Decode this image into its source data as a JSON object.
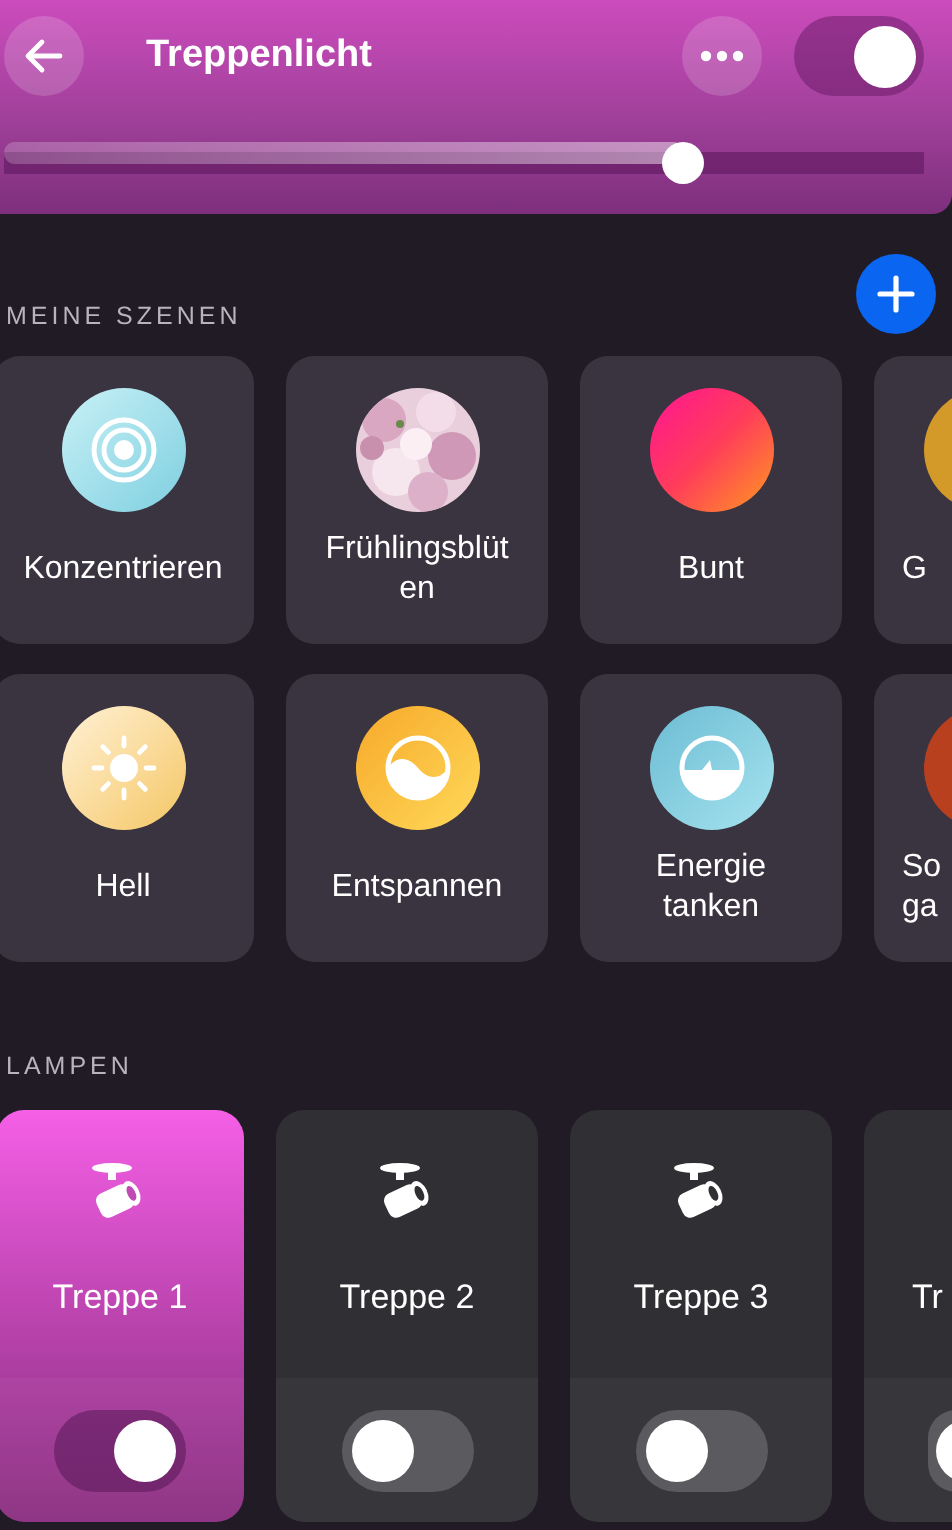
{
  "header": {
    "title": "Treppenlicht",
    "on": true,
    "level": 0.74
  },
  "scenes_section": {
    "title": "MEINE SZENEN"
  },
  "scenes": [
    {
      "name": "Konzentrieren",
      "kind": "concentrate"
    },
    {
      "name": "Frühlingsblüten",
      "kind": "picture"
    },
    {
      "name": "Bunt",
      "kind": "gradient"
    },
    {
      "name": "G",
      "kind": "partial-gold"
    },
    {
      "name": "Hell",
      "kind": "sun"
    },
    {
      "name": "Entspannen",
      "kind": "relax"
    },
    {
      "name": "Energie tanken",
      "kind": "energy"
    },
    {
      "name": "So ga",
      "kind": "partial-red"
    }
  ],
  "lamps_section": {
    "title": "LAMPEN"
  },
  "lamps": [
    {
      "name": "Treppe 1",
      "on": true
    },
    {
      "name": "Treppe 2",
      "on": false
    },
    {
      "name": "Treppe 3",
      "on": false
    },
    {
      "name": "Tr",
      "on": false
    }
  ]
}
